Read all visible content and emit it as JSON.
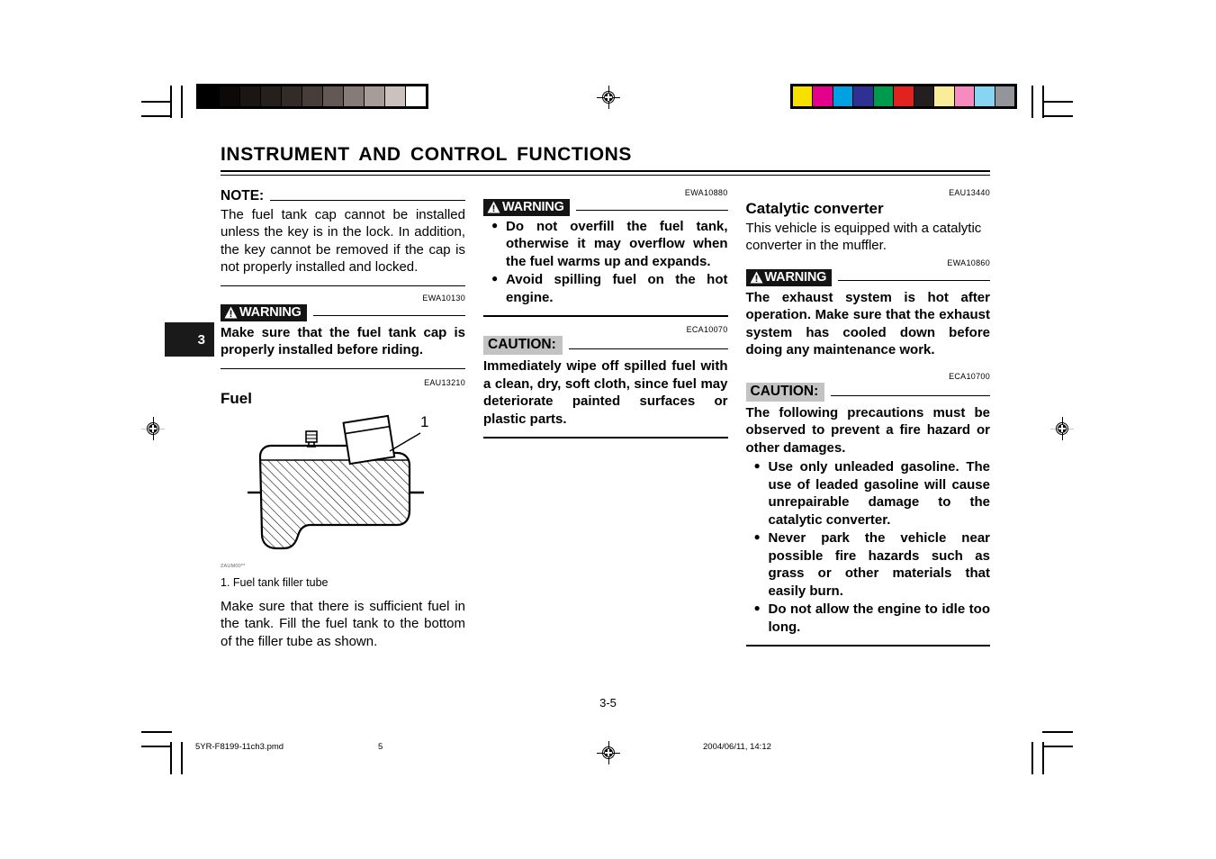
{
  "document": {
    "page_title": "INSTRUMENT AND CONTROL FUNCTIONS",
    "page_number": "3-5",
    "chapter_tab": "3"
  },
  "prepress": {
    "grayscale_swatches": [
      "#000000",
      "#0c0908",
      "#1b1613",
      "#26201c",
      "#332b27",
      "#473d39",
      "#635853",
      "#867b76",
      "#a79c98",
      "#cbc1bd",
      "#ffffff"
    ],
    "color_swatches": [
      "#f5e000",
      "#e5008c",
      "#00a0e2",
      "#2e3192",
      "#009a4e",
      "#e1231f",
      "#231f20",
      "#faed9a",
      "#f78bbf",
      "#86d5f2",
      "#939598"
    ]
  },
  "left_column": {
    "note": {
      "label": "NOTE:",
      "body": "The fuel tank cap cannot be installed unless the key is in the lock. In addition, the key cannot be removed if the cap is not properly installed and locked."
    },
    "warning": {
      "code": "EWA10130",
      "label": "WARNING",
      "body": "Make sure that the fuel tank cap is properly installed before riding."
    },
    "fuel_section": {
      "code": "EAU13210",
      "heading": "Fuel",
      "figure_id": "ZAUM00**",
      "callout_number": "1",
      "caption": "1.  Fuel tank filler tube",
      "body": "Make sure that there is sufficient fuel in the tank. Fill the fuel tank to the bottom of the filler tube as shown."
    }
  },
  "middle_column": {
    "warning": {
      "code": "EWA10880",
      "label": "WARNING",
      "bullets": [
        "Do not overfill the fuel tank, otherwise it may overflow when the fuel warms up and expands.",
        "Avoid spilling fuel on the hot engine."
      ]
    },
    "caution": {
      "code": "ECA10070",
      "label": "CAUTION:",
      "body": "Immediately wipe off spilled fuel with a clean, dry, soft cloth, since fuel may deteriorate painted surfaces or plastic parts."
    }
  },
  "right_column": {
    "catalytic": {
      "code": "EAU13440",
      "heading": "Catalytic converter",
      "body": "This vehicle is equipped with a catalytic converter in the muffler."
    },
    "warning": {
      "code": "EWA10860",
      "label": "WARNING",
      "body": "The exhaust system is hot after operation. Make sure that the exhaust system has cooled down before doing any maintenance work."
    },
    "caution": {
      "code": "ECA10700",
      "label": "CAUTION:",
      "body": "The following precautions must be observed to prevent a fire hazard or other damages.",
      "bullets": [
        "Use only unleaded gasoline. The use of leaded gasoline will cause unrepairable damage to the catalytic converter.",
        "Never park the vehicle near possible fire hazards such as grass or other materials that easily burn.",
        "Do not allow the engine to idle too long."
      ]
    }
  },
  "footer": {
    "filename": "5YR-F8199-11ch3.pmd",
    "sheet_number": "5",
    "timestamp": "2004/06/11, 14:12"
  }
}
